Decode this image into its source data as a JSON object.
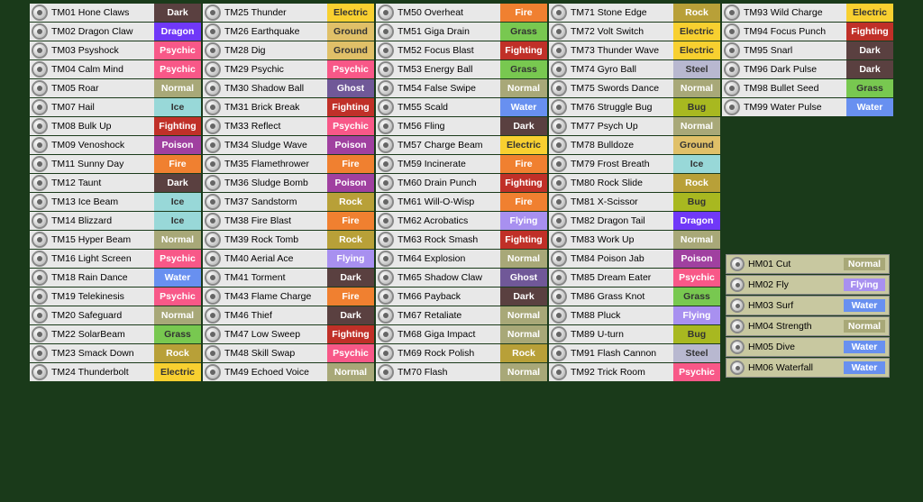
{
  "columns": [
    {
      "id": "col1",
      "items": [
        {
          "id": "TM01",
          "name": "Hone Claws",
          "type": "Dark"
        },
        {
          "id": "TM02",
          "name": "Dragon Claw",
          "type": "Dragon"
        },
        {
          "id": "TM03",
          "name": "Psyshock",
          "type": "Psychic"
        },
        {
          "id": "TM04",
          "name": "Calm Mind",
          "type": "Psychic"
        },
        {
          "id": "TM05",
          "name": "Roar",
          "type": "Normal"
        },
        {
          "id": "TM07",
          "name": "Hail",
          "type": "Ice"
        },
        {
          "id": "TM08",
          "name": "Bulk Up",
          "type": "Fighting"
        },
        {
          "id": "TM09",
          "name": "Venoshock",
          "type": "Poison"
        },
        {
          "id": "TM11",
          "name": "Sunny Day",
          "type": "Fire"
        },
        {
          "id": "TM12",
          "name": "Taunt",
          "type": "Dark"
        },
        {
          "id": "TM13",
          "name": "Ice Beam",
          "type": "Ice"
        },
        {
          "id": "TM14",
          "name": "Blizzard",
          "type": "Ice"
        },
        {
          "id": "TM15",
          "name": "Hyper Beam",
          "type": "Normal"
        },
        {
          "id": "TM16",
          "name": "Light Screen",
          "type": "Psychic"
        },
        {
          "id": "TM18",
          "name": "Rain Dance",
          "type": "Water"
        },
        {
          "id": "TM19",
          "name": "Telekinesis",
          "type": "Psychic"
        },
        {
          "id": "TM20",
          "name": "Safeguard",
          "type": "Normal"
        },
        {
          "id": "TM22",
          "name": "SolarBeam",
          "type": "Grass"
        },
        {
          "id": "TM23",
          "name": "Smack Down",
          "type": "Rock"
        },
        {
          "id": "TM24",
          "name": "Thunderbolt",
          "type": "Electric"
        }
      ]
    },
    {
      "id": "col2",
      "items": [
        {
          "id": "TM25",
          "name": "Thunder",
          "type": "Electric"
        },
        {
          "id": "TM26",
          "name": "Earthquake",
          "type": "Ground"
        },
        {
          "id": "TM28",
          "name": "Dig",
          "type": "Ground"
        },
        {
          "id": "TM29",
          "name": "Psychic",
          "type": "Psychic"
        },
        {
          "id": "TM30",
          "name": "Shadow Ball",
          "type": "Ghost"
        },
        {
          "id": "TM31",
          "name": "Brick Break",
          "type": "Fighting"
        },
        {
          "id": "TM33",
          "name": "Reflect",
          "type": "Psychic"
        },
        {
          "id": "TM34",
          "name": "Sludge Wave",
          "type": "Poison"
        },
        {
          "id": "TM35",
          "name": "Flamethrower",
          "type": "Fire"
        },
        {
          "id": "TM36",
          "name": "Sludge Bomb",
          "type": "Poison"
        },
        {
          "id": "TM37",
          "name": "Sandstorm",
          "type": "Rock"
        },
        {
          "id": "TM38",
          "name": "Fire Blast",
          "type": "Fire"
        },
        {
          "id": "TM39",
          "name": "Rock Tomb",
          "type": "Rock"
        },
        {
          "id": "TM40",
          "name": "Aerial Ace",
          "type": "Flying"
        },
        {
          "id": "TM41",
          "name": "Torment",
          "type": "Dark"
        },
        {
          "id": "TM43",
          "name": "Flame Charge",
          "type": "Fire"
        },
        {
          "id": "TM46",
          "name": "Thief",
          "type": "Dark"
        },
        {
          "id": "TM47",
          "name": "Low Sweep",
          "type": "Fighting"
        },
        {
          "id": "TM48",
          "name": "Skill Swap",
          "type": "Psychic"
        },
        {
          "id": "TM49",
          "name": "Echoed Voice",
          "type": "Normal"
        }
      ]
    },
    {
      "id": "col3",
      "items": [
        {
          "id": "TM50",
          "name": "Overheat",
          "type": "Fire"
        },
        {
          "id": "TM51",
          "name": "Giga Drain",
          "type": "Grass"
        },
        {
          "id": "TM52",
          "name": "Focus Blast",
          "type": "Fighting"
        },
        {
          "id": "TM53",
          "name": "Energy Ball",
          "type": "Grass"
        },
        {
          "id": "TM54",
          "name": "False Swipe",
          "type": "Normal"
        },
        {
          "id": "TM55",
          "name": "Scald",
          "type": "Water"
        },
        {
          "id": "TM56",
          "name": "Fling",
          "type": "Dark"
        },
        {
          "id": "TM57",
          "name": "Charge Beam",
          "type": "Electric"
        },
        {
          "id": "TM59",
          "name": "Incinerate",
          "type": "Fire"
        },
        {
          "id": "TM60",
          "name": "Drain Punch",
          "type": "Fighting"
        },
        {
          "id": "TM61",
          "name": "Will-O-Wisp",
          "type": "Fire"
        },
        {
          "id": "TM62",
          "name": "Acrobatics",
          "type": "Flying"
        },
        {
          "id": "TM63",
          "name": "Rock Smash",
          "type": "Fighting"
        },
        {
          "id": "TM64",
          "name": "Explosion",
          "type": "Normal"
        },
        {
          "id": "TM65",
          "name": "Shadow Claw",
          "type": "Ghost"
        },
        {
          "id": "TM66",
          "name": "Payback",
          "type": "Dark"
        },
        {
          "id": "TM67",
          "name": "Retaliate",
          "type": "Normal"
        },
        {
          "id": "TM68",
          "name": "Giga Impact",
          "type": "Normal"
        },
        {
          "id": "TM69",
          "name": "Rock Polish",
          "type": "Rock"
        },
        {
          "id": "TM70",
          "name": "Flash",
          "type": "Normal"
        }
      ]
    },
    {
      "id": "col4",
      "items": [
        {
          "id": "TM71",
          "name": "Stone Edge",
          "type": "Rock"
        },
        {
          "id": "TM72",
          "name": "Volt Switch",
          "type": "Electric"
        },
        {
          "id": "TM73",
          "name": "Thunder Wave",
          "type": "Electric"
        },
        {
          "id": "TM74",
          "name": "Gyro Ball",
          "type": "Steel"
        },
        {
          "id": "TM75",
          "name": "Swords Dance",
          "type": "Normal"
        },
        {
          "id": "TM76",
          "name": "Struggle Bug",
          "type": "Bug"
        },
        {
          "id": "TM77",
          "name": "Psych Up",
          "type": "Normal"
        },
        {
          "id": "TM78",
          "name": "Bulldoze",
          "type": "Ground"
        },
        {
          "id": "TM79",
          "name": "Frost Breath",
          "type": "Ice"
        },
        {
          "id": "TM80",
          "name": "Rock Slide",
          "type": "Rock"
        },
        {
          "id": "TM81",
          "name": "X-Scissor",
          "type": "Bug"
        },
        {
          "id": "TM82",
          "name": "Dragon Tail",
          "type": "Dragon"
        },
        {
          "id": "TM83",
          "name": "Work Up",
          "type": "Normal"
        },
        {
          "id": "TM84",
          "name": "Poison Jab",
          "type": "Poison"
        },
        {
          "id": "TM85",
          "name": "Dream Eater",
          "type": "Psychic"
        },
        {
          "id": "TM86",
          "name": "Grass Knot",
          "type": "Grass"
        },
        {
          "id": "TM88",
          "name": "Pluck",
          "type": "Flying"
        },
        {
          "id": "TM89",
          "name": "U-turn",
          "type": "Bug"
        },
        {
          "id": "TM91",
          "name": "Flash Cannon",
          "type": "Steel"
        },
        {
          "id": "TM92",
          "name": "Trick Room",
          "type": "Psychic"
        }
      ]
    },
    {
      "id": "col5",
      "items": [
        {
          "id": "TM93",
          "name": "Wild Charge",
          "type": "Electric"
        },
        {
          "id": "TM94",
          "name": "Focus Punch",
          "type": "Fighting"
        },
        {
          "id": "TM95",
          "name": "Snarl",
          "type": "Dark"
        },
        {
          "id": "TM96",
          "name": "Dark Pulse",
          "type": "Dark"
        },
        {
          "id": "TM98",
          "name": "Bullet Seed",
          "type": "Grass"
        },
        {
          "id": "TM99",
          "name": "Water Pulse",
          "type": "Water"
        }
      ]
    }
  ],
  "hms": [
    {
      "id": "HM01",
      "name": "Cut",
      "type": "Normal"
    },
    {
      "id": "HM02",
      "name": "Fly",
      "type": "Flying"
    },
    {
      "id": "HM03",
      "name": "Surf",
      "type": "Water"
    },
    {
      "id": "HM04",
      "name": "Strength",
      "type": "Normal"
    },
    {
      "id": "HM05",
      "name": "Dive",
      "type": "Water"
    },
    {
      "id": "HM06",
      "name": "Waterfall",
      "type": "Water"
    }
  ]
}
